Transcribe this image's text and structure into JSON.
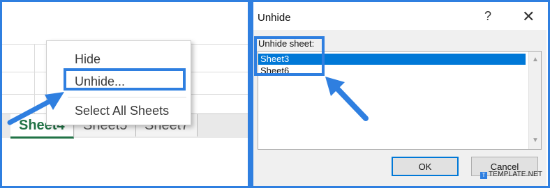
{
  "spreadsheet": {
    "sheet_tabs": [
      "Sheet4",
      "Sheet5",
      "Sheet7"
    ],
    "active_tab_index": 0
  },
  "context_menu": {
    "items": [
      {
        "label": "Hide"
      },
      {
        "label": "Unhide..."
      },
      {
        "label": "Select All Sheets"
      }
    ]
  },
  "dialog": {
    "title": "Unhide",
    "help_glyph": "?",
    "close_glyph": "✕",
    "list_label": "Unhide sheet:",
    "list_items": [
      "Sheet3",
      "Sheet6"
    ],
    "selected_index": 0,
    "ok_label": "OK",
    "cancel_label": "Cancel"
  },
  "watermark": "TEMPLATE.NET",
  "colors": {
    "highlight": "#2f7fe0",
    "excel_green": "#217346",
    "selection": "#0078d7"
  }
}
